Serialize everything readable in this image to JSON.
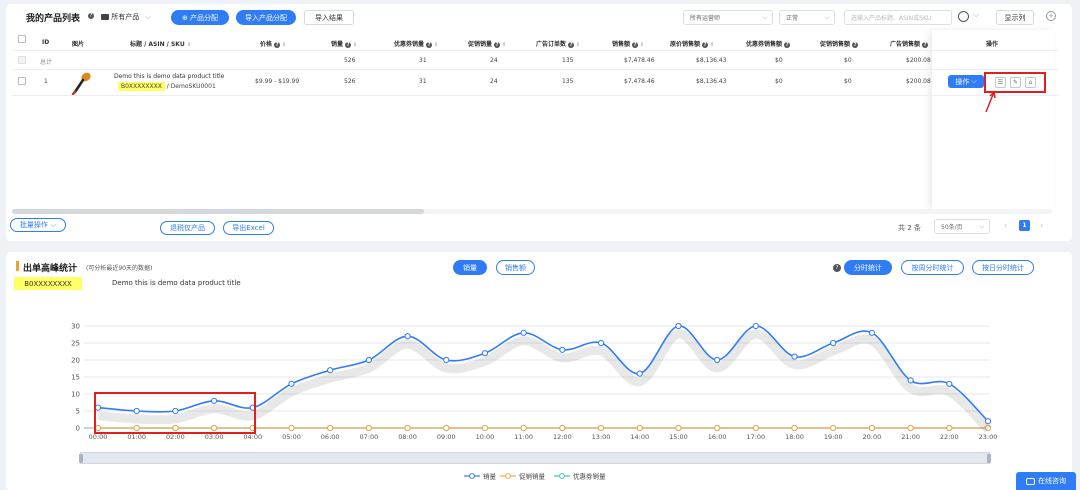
{
  "product_list": {
    "title": "我的产品列表",
    "folder_label": "所有产品",
    "btn_product_assign": "⊕ 产品分配",
    "btn_import_assign": "导入产品分配",
    "btn_import_result": "导入结果",
    "filter_status_dropdown": "所有运营师",
    "filter_normal": "正常",
    "search_placeholder": "选输入产品标题、ASIN或SKU",
    "btn_custom_columns": "显示列"
  },
  "table": {
    "headers": [
      "ID",
      "图片",
      "标题 / ASIN / SKU",
      "价格",
      "销量",
      "优惠券销量",
      "促销销量",
      "广告订单数",
      "销售额",
      "原价销售额",
      "优惠券销售额",
      "促销销售额",
      "广告销售额",
      "操作"
    ],
    "total_row": {
      "label": "总计",
      "sales": "526",
      "coupon_sales": "31",
      "promo_sales": "24",
      "ad_orders": "135",
      "revenue": "$7,478.46",
      "original_revenue": "$8,136.43",
      "coupon_revenue": "$0",
      "promo_revenue": "$0",
      "ad_revenue": "$200.08"
    },
    "rows": [
      {
        "id": "1",
        "title": "Demo this is demo data product title",
        "asin": "B0XXXXXXXX",
        "sku": "DemoSKU0001",
        "price": "$9.99 - $19.99",
        "sales": "526",
        "coupon_sales": "31",
        "promo_sales": "24",
        "ad_orders": "135",
        "revenue": "$7,478.46",
        "original_revenue": "$8,136.43",
        "coupon_revenue": "$0",
        "promo_revenue": "$0",
        "ad_revenue": "$200.08",
        "action_label": "操作"
      }
    ]
  },
  "footer": {
    "btn_batch": "批量操作",
    "btn_transfer": "退税仅产品",
    "btn_export": "导出Excel",
    "total_count": "共 2 条",
    "page_size": "50条/页",
    "current_page": "1"
  },
  "chart_section": {
    "title": "出单高峰统计",
    "subtitle": "(可分析最近90天的数据)",
    "asin_badge": "B0XXXXXXXX",
    "product_title": "Demo this is demo data product title",
    "tab_sales": "销量",
    "tab_revenue": "销售额",
    "btn_hourly": "分时统计",
    "btn_weekly": "按周分时统计",
    "btn_monthly": "按日分时统计",
    "chat_label": "在线咨询"
  },
  "chart_data": {
    "type": "line",
    "x": [
      "00:00",
      "01:00",
      "02:00",
      "03:00",
      "04:00",
      "05:00",
      "06:00",
      "07:00",
      "08:00",
      "09:00",
      "10:00",
      "11:00",
      "12:00",
      "13:00",
      "14:00",
      "15:00",
      "16:00",
      "17:00",
      "18:00",
      "19:00",
      "20:00",
      "21:00",
      "22:00",
      "23:00"
    ],
    "ylim": [
      0,
      30
    ],
    "yticks": [
      0,
      5,
      10,
      15,
      20,
      25,
      30
    ],
    "series": [
      {
        "name": "销量",
        "color": "#2f7cf6",
        "values": [
          6,
          5,
          5,
          8,
          6,
          13,
          17,
          20,
          27,
          20,
          22,
          28,
          23,
          25,
          16,
          30,
          20,
          30,
          21,
          25,
          28,
          14,
          13,
          2
        ]
      },
      {
        "name": "促销销量",
        "color": "#f0a64a",
        "values": [
          0,
          0,
          0,
          0,
          0,
          0,
          0,
          0,
          0,
          0,
          0,
          0,
          0,
          0,
          0,
          0,
          0,
          0,
          0,
          0,
          0,
          0,
          0,
          0
        ]
      },
      {
        "name": "优惠券销量",
        "color": "#3cc7b4",
        "values": [
          0,
          0,
          0,
          0,
          0,
          0,
          0,
          0,
          0,
          0,
          0,
          0,
          0,
          0,
          0,
          0,
          0,
          0,
          0,
          0,
          0,
          0,
          0,
          0
        ]
      }
    ],
    "legend": "bottom",
    "grid": true
  }
}
